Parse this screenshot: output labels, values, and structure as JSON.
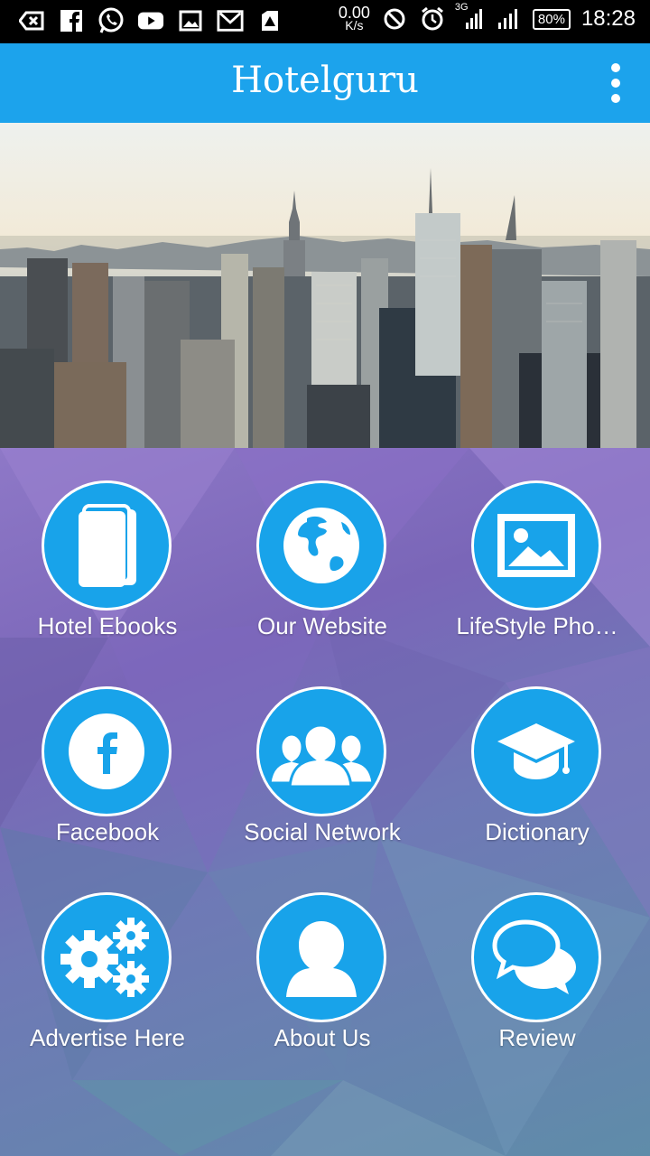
{
  "status_bar": {
    "speed_value": "0.00",
    "speed_unit": "K/s",
    "network": "3G",
    "battery": "80%",
    "time": "18:28"
  },
  "app_bar": {
    "title": "Hotelguru"
  },
  "colors": {
    "app_bar": "#1ca3ec",
    "tile_circle": "#18a3ea",
    "white": "#ffffff"
  },
  "menu": {
    "items": [
      {
        "label": "Hotel Ebooks",
        "icon": "book-icon"
      },
      {
        "label": "Our Website",
        "icon": "globe-icon"
      },
      {
        "label": "LifeStyle Pho…",
        "icon": "image-icon"
      },
      {
        "label": "Facebook",
        "icon": "facebook-icon"
      },
      {
        "label": "Social Network",
        "icon": "group-icon"
      },
      {
        "label": "Dictionary",
        "icon": "graduation-cap-icon"
      },
      {
        "label": "Advertise Here",
        "icon": "gears-icon"
      },
      {
        "label": "About Us",
        "icon": "person-icon"
      },
      {
        "label": "Review",
        "icon": "chat-bubbles-icon"
      }
    ]
  }
}
